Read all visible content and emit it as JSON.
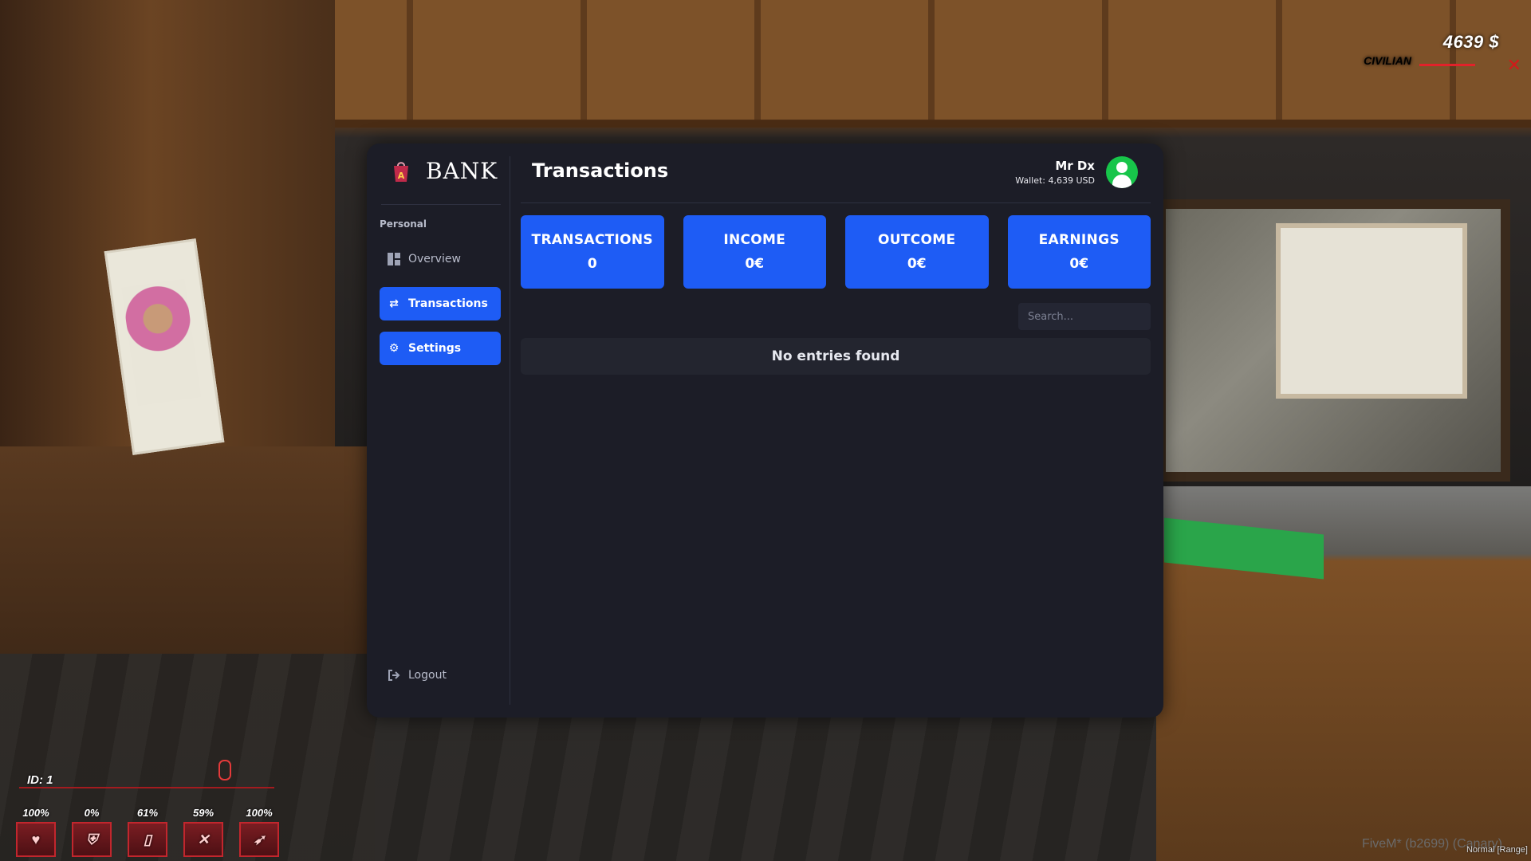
{
  "hud": {
    "money": "4639 $",
    "role": "CIVILIAN",
    "player_id": "ID: 1",
    "stats": [
      {
        "value": "100%",
        "icon": "heart-icon"
      },
      {
        "value": "0%",
        "icon": "shield-icon"
      },
      {
        "value": "61%",
        "icon": "drink-icon"
      },
      {
        "value": "59%",
        "icon": "food-icon"
      },
      {
        "value": "100%",
        "icon": "stamina-icon"
      }
    ],
    "fivem_label": "FiveM* (b2699) (Canary)",
    "voice_mode": "Normal [Range]"
  },
  "bank": {
    "brand": "BANK",
    "sidebar": {
      "section_label": "Personal",
      "items": [
        {
          "label": "Overview",
          "icon": "grid-icon"
        },
        {
          "label": "Transactions",
          "icon": "exchange-icon"
        },
        {
          "label": "Settings",
          "icon": "gear-icon"
        }
      ],
      "logout_label": "Logout"
    },
    "page_title": "Transactions",
    "user": {
      "name": "Mr Dx",
      "wallet": "Wallet: 4,639 USD"
    },
    "cards": [
      {
        "label": "TRANSACTIONS",
        "value": "0"
      },
      {
        "label": "INCOME",
        "value": "0€"
      },
      {
        "label": "OUTCOME",
        "value": "0€"
      },
      {
        "label": "EARNINGS",
        "value": "0€"
      }
    ],
    "search": {
      "placeholder": "Search...",
      "value": ""
    },
    "empty_message": "No entries found",
    "colors": {
      "accent": "#1e5cf5",
      "panel": "#1c1d27",
      "avatar": "#17c54a"
    }
  }
}
